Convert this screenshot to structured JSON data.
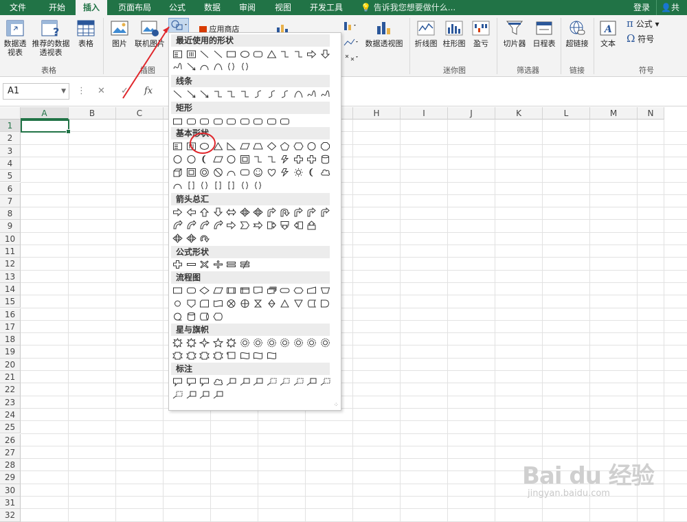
{
  "tabs": [
    {
      "label": "文件",
      "active": false
    },
    {
      "label": "开始",
      "active": false
    },
    {
      "label": "插入",
      "active": true
    },
    {
      "label": "页面布局",
      "active": false
    },
    {
      "label": "公式",
      "active": false
    },
    {
      "label": "数据",
      "active": false
    },
    {
      "label": "审阅",
      "active": false
    },
    {
      "label": "视图",
      "active": false
    },
    {
      "label": "开发工具",
      "active": false
    }
  ],
  "tell_me": "告诉我您想要做什么...",
  "login": "登录",
  "share": "共享",
  "ribbon": {
    "pivot_table": "数据透视表",
    "recommended_pivot": "推荐的数据透视表",
    "table": "表格",
    "group_tables": "表格",
    "picture": "图片",
    "online_picture": "联机图片",
    "group_illustrations": "插图",
    "app_store": "应用商店",
    "pivot_chart": "数据透视图",
    "line": "折线图",
    "column": "柱形图",
    "win_loss": "盈亏",
    "group_sparklines": "迷你图",
    "slicer": "切片器",
    "timeline": "日程表",
    "group_filters": "筛选器",
    "hyperlink": "超链接",
    "group_links": "链接",
    "text": "文本",
    "equation": "公式",
    "symbol": "符号",
    "group_symbols": "符号"
  },
  "name_box": "A1",
  "columns": [
    "A",
    "B",
    "C",
    "D",
    "E",
    "F",
    "G",
    "H",
    "I",
    "J",
    "K",
    "L",
    "M",
    "N"
  ],
  "rows": [
    "1",
    "2",
    "3",
    "4",
    "5",
    "6",
    "7",
    "8",
    "9",
    "10",
    "11",
    "12",
    "13",
    "14",
    "15",
    "16",
    "17",
    "18",
    "19",
    "20",
    "21",
    "22",
    "23",
    "24",
    "25",
    "26",
    "27",
    "28",
    "29",
    "30",
    "31",
    "32"
  ],
  "sections": [
    {
      "title": "最近使用的形状"
    },
    {
      "title": "线条"
    },
    {
      "title": "矩形"
    },
    {
      "title": "基本形状"
    },
    {
      "title": "箭头总汇"
    },
    {
      "title": "公式形状"
    },
    {
      "title": "流程图"
    },
    {
      "title": "星与旗帜"
    },
    {
      "title": "标注"
    }
  ],
  "watermark": {
    "brand": "Bai du 经验",
    "url": "jingyan.baidu.com"
  },
  "colors": {
    "accent": "#217346",
    "annotation": "#e0262b"
  }
}
